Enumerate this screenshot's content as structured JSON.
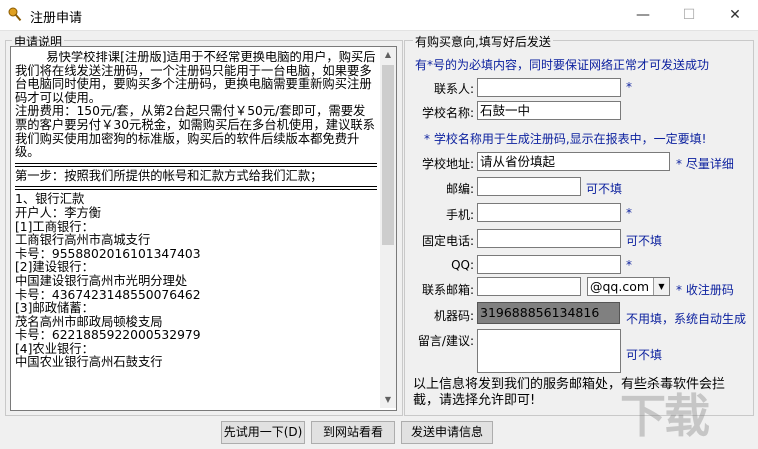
{
  "window": {
    "title": "注册申请",
    "min_symbol": "—",
    "max_symbol": "☐",
    "close_symbol": "✕"
  },
  "left_group": {
    "legend": "申请说明",
    "paragraph1": "        易快学校排课[注册版]适用于不经常更换电脑的用户，购买后我们将在线发送注册码，一个注册码只能用于一台电脑，如果要多台电脑同时使用，要购买多个注册码，更换电脑需要重新购买注册码才可以使用。\n注册费用：150元/套，从第2台起只需付￥50元/套即可，需要发票的客户要另付￥30元税金，如需购买后在多台机使用，建议联系我们购买使用加密狗的标准版，购买后的软件后续版本都免费升级。",
    "step1": "第一步：按照我们所提供的帐号和汇款方式给我们汇款；",
    "bank_section": "1、银行汇款\n开户人：李方衡\n[1]工商银行：\n工商银行高州市高城支行\n卡号：9558802016101347403\n[2]建设银行：\n中国建设银行高州市光明分理处\n卡号：4367423148550076462\n[3]邮政储蓄：\n茂名高州市邮政局顿梭支局\n卡号：6221885922000532979\n[4]农业银行：\n中国农业银行高州石鼓支行"
  },
  "right_group": {
    "legend": "有购买意向,填写好后发送",
    "top_note": "有*号的为必填内容，同时要保证网络正常才可发送成功",
    "fields": {
      "contact": {
        "label": "联系人:",
        "value": "",
        "note": "*"
      },
      "school_name": {
        "label": "学校名称:",
        "value": "石鼓一中",
        "note": ""
      },
      "school_address": {
        "label": "学校地址:",
        "value": "请从省份填起",
        "note": "* 尽量详细"
      },
      "postcode": {
        "label": "邮编:",
        "value": "",
        "note": "可不填"
      },
      "mobile": {
        "label": "手机:",
        "value": "",
        "note": "*"
      },
      "phone": {
        "label": "固定电话:",
        "value": "",
        "note": "可不填"
      },
      "qq": {
        "label": "QQ:",
        "value": "",
        "note": "*"
      },
      "email": {
        "label": "联系邮箱:",
        "value": "",
        "domain": "@qq.com",
        "note": "* 收注册码"
      },
      "machine_code": {
        "label": "机器码:",
        "value": "319688856134816",
        "note": "不用填，系统自动生成"
      },
      "message": {
        "label": "留言/建议:",
        "value": "",
        "note": "可不填"
      }
    },
    "school_name_note": "* 学校名称用于生成注册码,显示在报表中，一定要填!",
    "info_text": "以上信息将发到我们的服务邮箱处，有些杀毒软件会拦截，请选择允许即可!"
  },
  "buttons": {
    "trial": "先试用一下(D)",
    "website": "到网站看看",
    "send": "发送申请信息"
  },
  "watermark": "下载"
}
